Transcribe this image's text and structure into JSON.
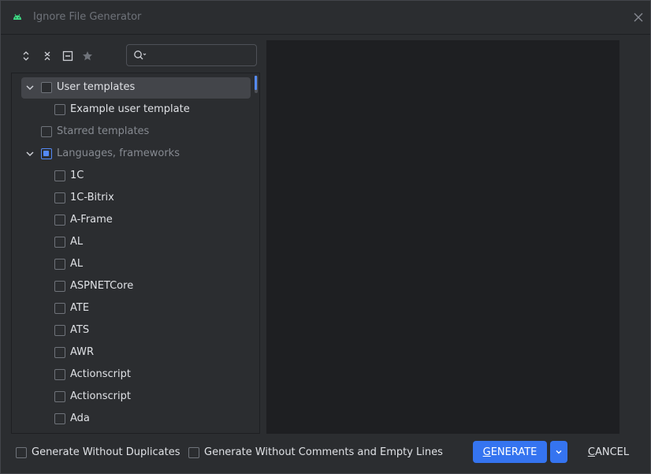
{
  "window": {
    "title": "Ignore File Generator",
    "app_icon": "android-icon",
    "close_icon": "close-icon"
  },
  "toolbar": {
    "buttons": [
      {
        "name": "expand-all",
        "icon": "expand-all-icon"
      },
      {
        "name": "collapse-all",
        "icon": "collapse-all-icon"
      },
      {
        "name": "unselect-all",
        "icon": "unselect-icon"
      },
      {
        "name": "star",
        "icon": "star-icon"
      }
    ]
  },
  "search": {
    "placeholder": "",
    "value": ""
  },
  "tree": {
    "rows": [
      {
        "label": "User templates",
        "level": 0,
        "expandable": true,
        "expanded": true,
        "checked": false,
        "dim": false,
        "selected": true
      },
      {
        "label": "Example user template",
        "level": 1,
        "expandable": false,
        "checked": false,
        "dim": false,
        "selected": false
      },
      {
        "label": "Starred templates",
        "level": 0,
        "expandable": false,
        "checked": false,
        "dim": true,
        "selected": false
      },
      {
        "label": "Languages, frameworks",
        "level": 0,
        "expandable": true,
        "expanded": true,
        "checked": true,
        "dim": true,
        "selected": false
      },
      {
        "label": "1C",
        "level": 1,
        "checked": false,
        "dim": false
      },
      {
        "label": "1C-Bitrix",
        "level": 1,
        "checked": false,
        "dim": false
      },
      {
        "label": "A-Frame",
        "level": 1,
        "checked": false,
        "dim": false
      },
      {
        "label": "AL",
        "level": 1,
        "checked": false,
        "dim": false
      },
      {
        "label": "AL",
        "level": 1,
        "checked": false,
        "dim": false
      },
      {
        "label": "ASPNETCore",
        "level": 1,
        "checked": false,
        "dim": false
      },
      {
        "label": "ATE",
        "level": 1,
        "checked": false,
        "dim": false
      },
      {
        "label": "ATS",
        "level": 1,
        "checked": false,
        "dim": false
      },
      {
        "label": "AWR",
        "level": 1,
        "checked": false,
        "dim": false
      },
      {
        "label": "Actionscript",
        "level": 1,
        "checked": false,
        "dim": false
      },
      {
        "label": "Actionscript",
        "level": 1,
        "checked": false,
        "dim": false
      },
      {
        "label": "Ada",
        "level": 1,
        "checked": false,
        "dim": false
      }
    ]
  },
  "footer": {
    "without_duplicates_label": "Generate Without Duplicates",
    "without_duplicates_checked": false,
    "without_comments_label": "Generate Without Comments and Empty Lines",
    "without_comments_checked": false,
    "generate_mnemonic": "G",
    "generate_rest": "ENERATE",
    "cancel_mnemonic": "C",
    "cancel_rest": "ANCEL"
  },
  "colors": {
    "accent": "#3574f0",
    "checked": "#548af7",
    "android_green": "#3ddc84",
    "background": "#2b2d30",
    "preview_bg": "#1e1f22"
  }
}
